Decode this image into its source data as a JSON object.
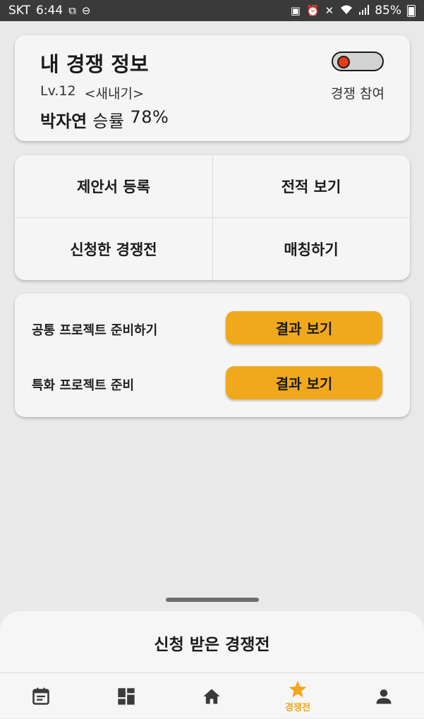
{
  "status_bar": {
    "carrier": "SKT",
    "time": "6:44",
    "battery": "85%"
  },
  "profile": {
    "title": "내 경쟁 정보",
    "level": "Lv.12",
    "rank": "<새내기>",
    "name": "박자연",
    "win_rate_label": "승률",
    "win_rate": "78%",
    "toggle_label": "경쟁 참여",
    "toggle_on": false,
    "toggle_knob_color": "#e53a14"
  },
  "menu": {
    "items": [
      {
        "label": "제안서 등록"
      },
      {
        "label": "전적 보기"
      },
      {
        "label": "신청한 경쟁전"
      },
      {
        "label": "매칭하기"
      }
    ]
  },
  "projects": {
    "rows": [
      {
        "label": "공통 프로젝트 준비하기",
        "button": "결과 보기"
      },
      {
        "label": "특화 프로젝트 준비",
        "button": "결과 보기"
      }
    ]
  },
  "sheet": {
    "title": "신청 받은 경쟁전"
  },
  "bottom_nav": {
    "items": [
      {
        "icon": "calendar-icon",
        "label": ""
      },
      {
        "icon": "dashboard-icon",
        "label": ""
      },
      {
        "icon": "home-icon",
        "label": ""
      },
      {
        "icon": "star-icon",
        "label": "경쟁전",
        "active": true
      },
      {
        "icon": "person-icon",
        "label": ""
      }
    ]
  },
  "colors": {
    "accent": "#f0a81c",
    "background": "#e9e9e9",
    "card": "#f5f5f5",
    "status_bar": "#3a3a3a"
  }
}
